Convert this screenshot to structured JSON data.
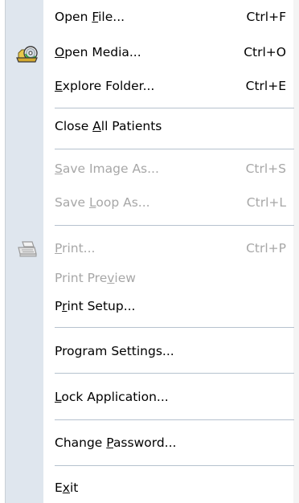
{
  "menu": {
    "open_file": {
      "pre": "Open ",
      "mn": "F",
      "post": "ile...",
      "shortcut": "Ctrl+F"
    },
    "open_media": {
      "pre": "",
      "mn": "O",
      "post": "pen Media...",
      "shortcut": "Ctrl+O"
    },
    "explore_folder": {
      "pre": "",
      "mn": "E",
      "post": "xplore Folder...",
      "shortcut": "Ctrl+E"
    },
    "close_all": {
      "pre": "Close ",
      "mn": "A",
      "post": "ll Patients"
    },
    "save_image_as": {
      "pre": "",
      "mn": "S",
      "post": "ave Image As...",
      "shortcut": "Ctrl+S"
    },
    "save_loop_as": {
      "pre": "Save ",
      "mn": "L",
      "post": "oop As...",
      "shortcut": "Ctrl+L"
    },
    "print": {
      "pre": "",
      "mn": "P",
      "post": "rint...",
      "shortcut": "Ctrl+P"
    },
    "print_preview": {
      "pre": "Print Pre",
      "mn": "v",
      "post": "iew"
    },
    "print_setup": {
      "pre": "P",
      "mn": "r",
      "post": "int Setup..."
    },
    "program_settings": {
      "pre": "Program Settings..."
    },
    "lock_application": {
      "pre": "",
      "mn": "L",
      "post": "ock Application..."
    },
    "change_password": {
      "pre": "Change ",
      "mn": "P",
      "post": "assword..."
    },
    "exit": {
      "pre": "E",
      "mn": "x",
      "post": "it"
    }
  },
  "icons": {
    "open_media": "disc-open-icon",
    "print": "printer-icon"
  },
  "colors": {
    "gutter": "#dfe6ee",
    "separator": "#b6c2ce",
    "disabled_text": "#a7a7a7",
    "text": "#000000"
  }
}
